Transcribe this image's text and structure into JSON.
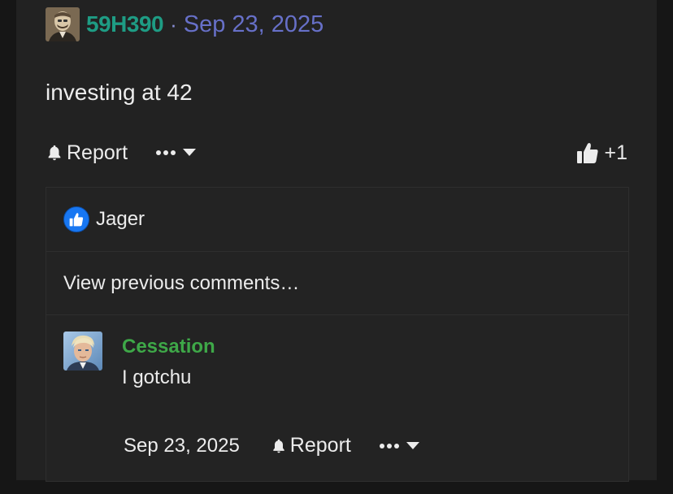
{
  "post": {
    "author": "59H390",
    "separator": "·",
    "date": "Sep 23, 2025",
    "body": "investing at 42",
    "actions": {
      "report_label": "Report",
      "like_count": "+1"
    }
  },
  "likes": {
    "liker_name": "Jager"
  },
  "comments": {
    "view_previous_label": "View previous comments…",
    "items": [
      {
        "author": "Cessation",
        "text": "I gotchu",
        "date": "Sep 23, 2025",
        "report_label": "Report"
      }
    ]
  },
  "colors": {
    "author": "#1e9c84",
    "date": "#6770c8",
    "comment_author": "#3ea848",
    "like_badge": "#1877f2"
  },
  "icons": [
    "bell-icon",
    "more-dots-icon",
    "caret-down-icon",
    "thumbs-up-icon"
  ]
}
